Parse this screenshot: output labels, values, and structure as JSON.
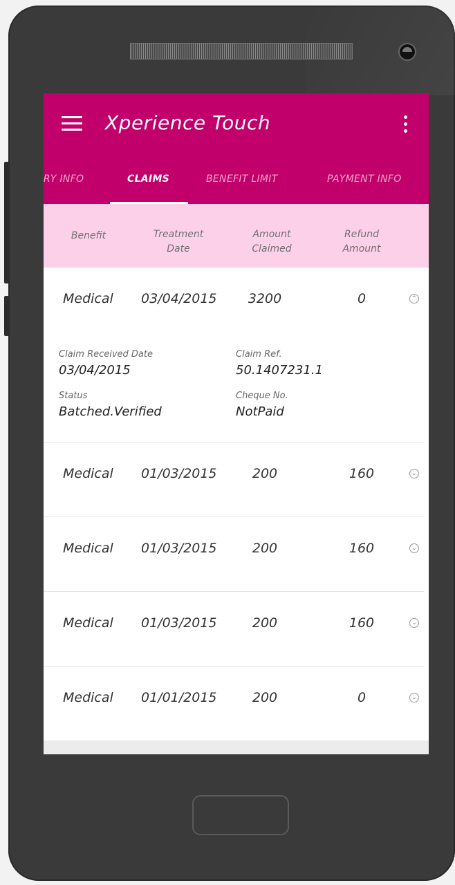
{
  "app": {
    "title": "Xperience Touch",
    "colors": {
      "primary": "#c2006b",
      "header_band": "#fdd0ea"
    },
    "icons": {
      "menu": "hamburger-icon",
      "overflow": "more-vertical-icon",
      "row_toggle": "chevron-down-circle-icon"
    }
  },
  "tabs": [
    {
      "label": "ARY INFO",
      "active": false
    },
    {
      "label": "CLAIMS",
      "active": true
    },
    {
      "label": "BENEFIT LIMIT",
      "active": false
    },
    {
      "label": "PAYMENT INFO",
      "active": false
    }
  ],
  "table": {
    "headers": [
      {
        "line1": "Benefit",
        "line2": ""
      },
      {
        "line1": "Treatment",
        "line2": "Date"
      },
      {
        "line1": "Amount",
        "line2": "Claimed"
      },
      {
        "line1": "Refund",
        "line2": "Amount"
      }
    ],
    "rows": [
      {
        "benefit": "Medical",
        "treatment_date": "03/04/2015",
        "amount_claimed": "3200",
        "refund_amount": "0",
        "expanded": true
      },
      {
        "benefit": "Medical",
        "treatment_date": "01/03/2015",
        "amount_claimed": "200",
        "refund_amount": "160",
        "expanded": false
      },
      {
        "benefit": "Medical",
        "treatment_date": "01/03/2015",
        "amount_claimed": "200",
        "refund_amount": "160",
        "expanded": false
      },
      {
        "benefit": "Medical",
        "treatment_date": "01/03/2015",
        "amount_claimed": "200",
        "refund_amount": "160",
        "expanded": false
      },
      {
        "benefit": "Medical",
        "treatment_date": "01/01/2015",
        "amount_claimed": "200",
        "refund_amount": "0",
        "expanded": false
      }
    ],
    "details": {
      "claim_received_date_label": "Claim Received Date",
      "claim_received_date": "03/04/2015",
      "claim_ref_label": "Claim Ref.",
      "claim_ref": "50.1407231.1",
      "status_label": "Status",
      "status": "Batched.Verified",
      "cheque_no_label": "Cheque No.",
      "cheque_no": "NotPaid"
    }
  }
}
